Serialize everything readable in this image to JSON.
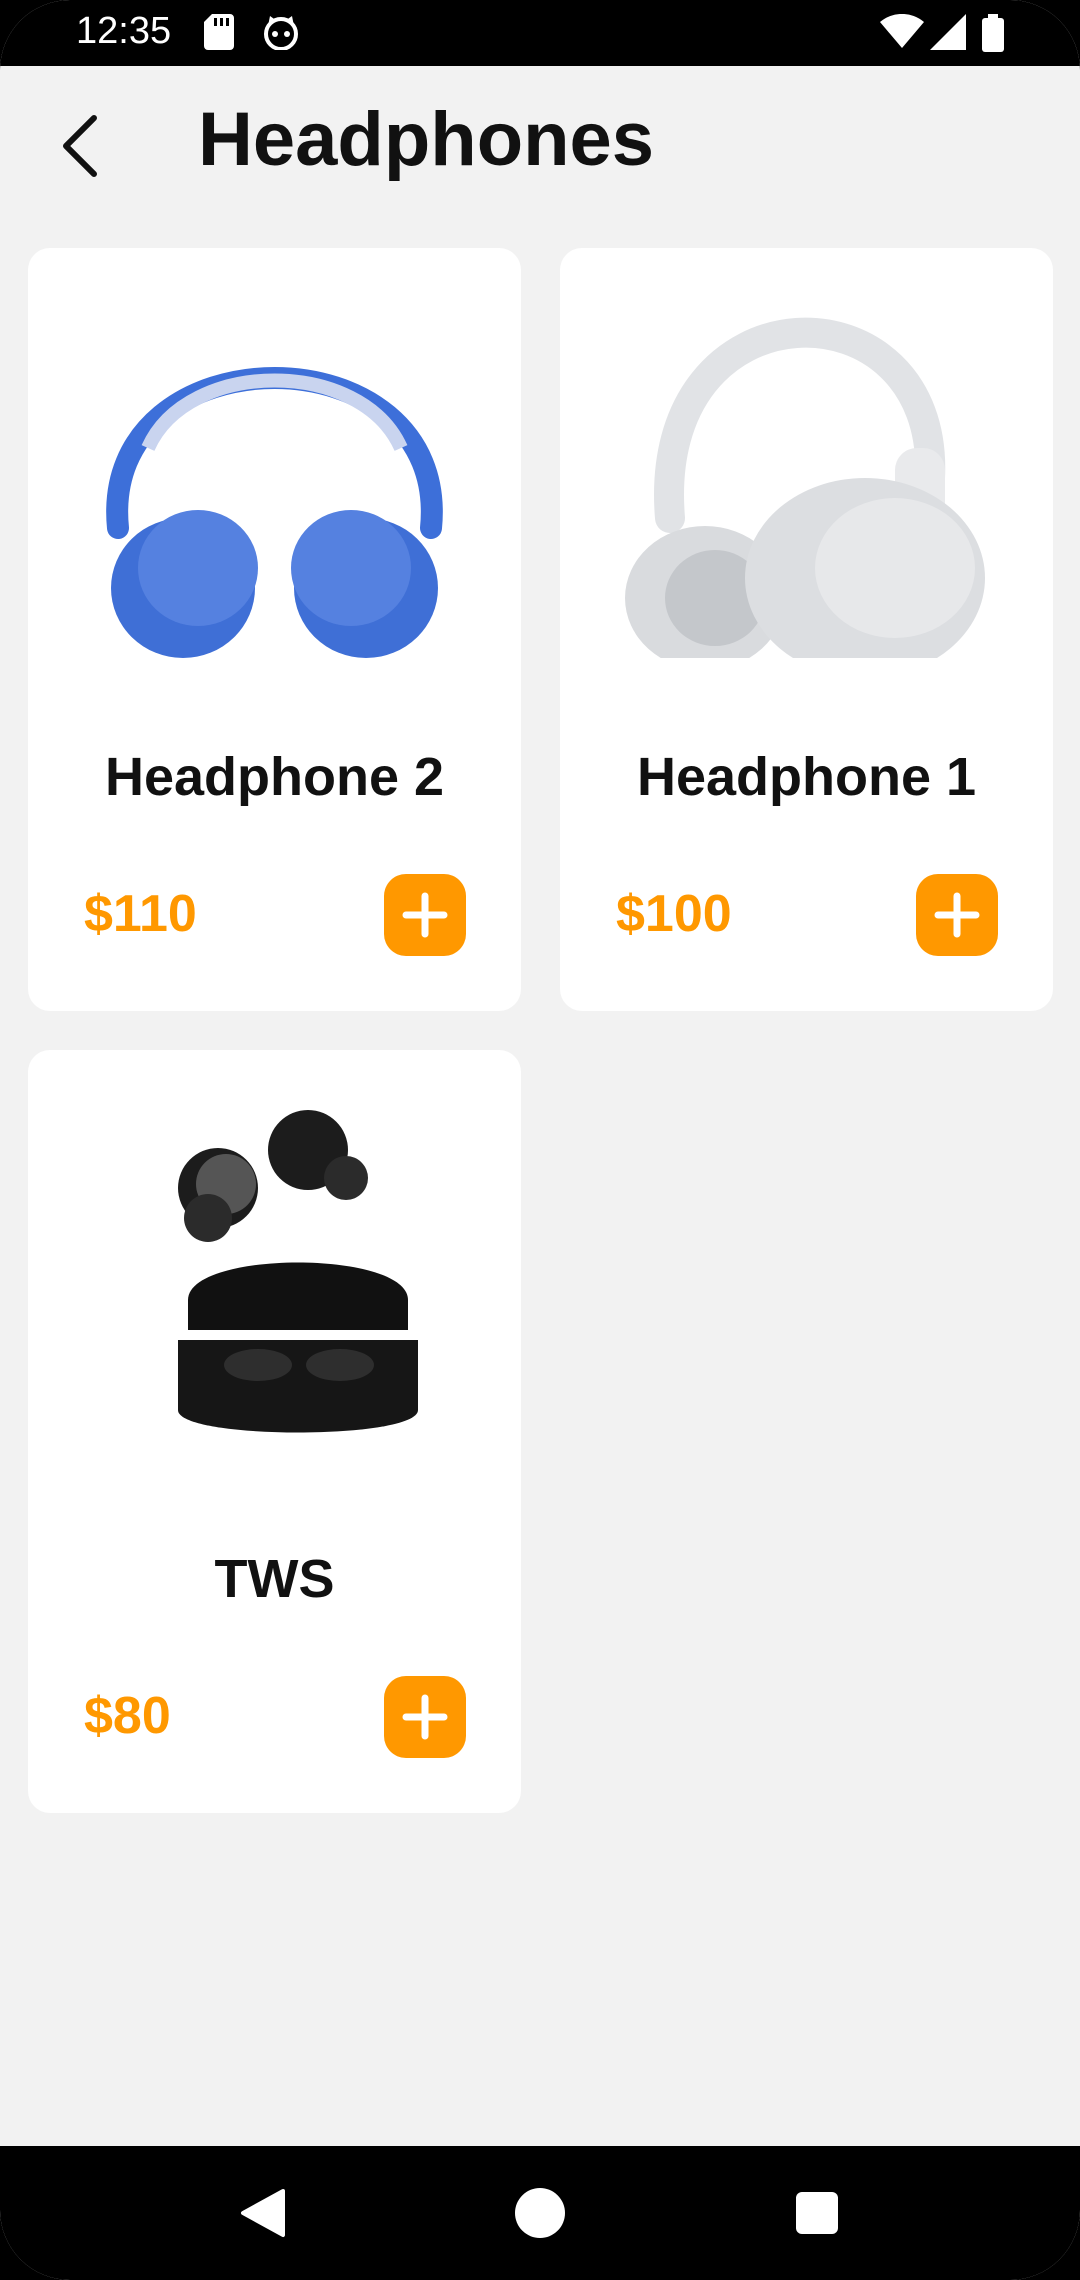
{
  "status_bar": {
    "time": "12:35",
    "icons_left": [
      "sd-card-icon",
      "cat-face-icon"
    ],
    "icons_right": [
      "wifi-icon",
      "signal-icon",
      "battery-icon"
    ]
  },
  "app_bar": {
    "back_icon": "chevron-left-icon",
    "title": "Headphones"
  },
  "products": [
    {
      "name": "Headphone 2",
      "price": "$110",
      "image": "blue-headphones",
      "image_color": "#3d6fd9"
    },
    {
      "name": "Headphone 1",
      "price": "$100",
      "image": "white-headphones",
      "image_color": "#e0e2e5"
    },
    {
      "name": "TWS",
      "price": "$80",
      "image": "black-earbuds",
      "image_color": "#1a1a1a"
    }
  ],
  "add_icon": "plus-icon",
  "accent_color": "#ff9800",
  "nav_bar": {
    "buttons": [
      "back-triangle-icon",
      "home-circle-icon",
      "recents-square-icon"
    ]
  }
}
